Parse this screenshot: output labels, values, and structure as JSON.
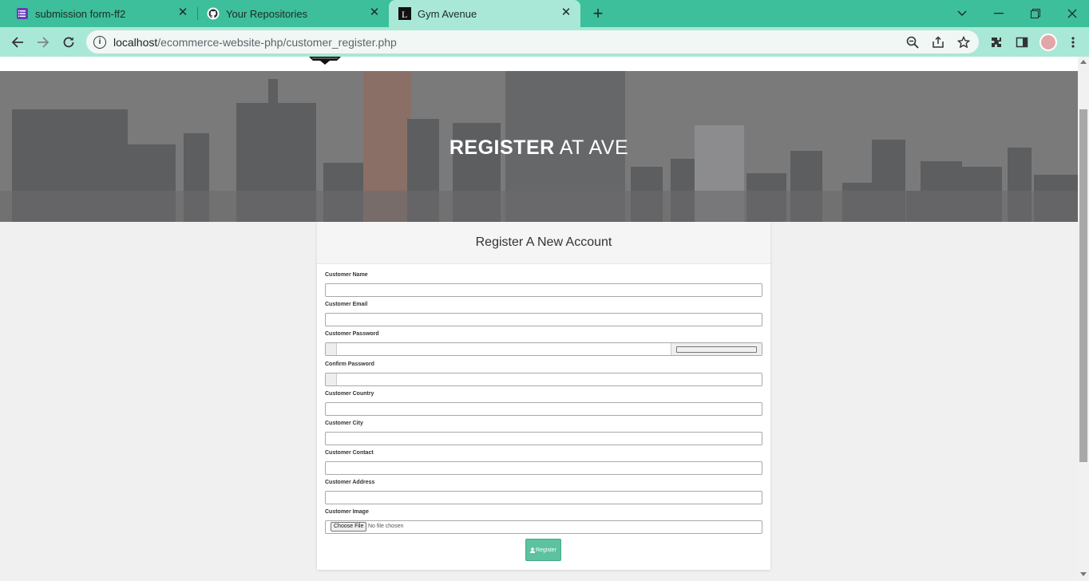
{
  "browser": {
    "tabs": [
      {
        "title": "submission form-ff2",
        "icon": "forms-icon"
      },
      {
        "title": "Your Repositories",
        "icon": "github-icon"
      },
      {
        "title": "Gym Avenue",
        "icon": "site-logo-icon"
      }
    ],
    "active_tab": 2,
    "url_host": "localhost",
    "url_path": "/ecommerce-website-php/customer_register.php",
    "accent_color": "#3cbf9a"
  },
  "hero": {
    "title_bold": "REGISTER",
    "title_rest": " AT AVE"
  },
  "form": {
    "heading": "Register A New Account",
    "fields": {
      "name": "Customer Name",
      "email": "Customer Email",
      "password": "Customer Password",
      "confirm_password": "Confirm Password",
      "country": "Customer Country",
      "city": "Customer City",
      "contact": "Customer Contact",
      "address": "Customer Address",
      "image": "Customer Image"
    },
    "file_button": "Choose File",
    "file_status": "No file chosen",
    "submit_label": "Register",
    "submit_color": "#5cc2a0"
  }
}
